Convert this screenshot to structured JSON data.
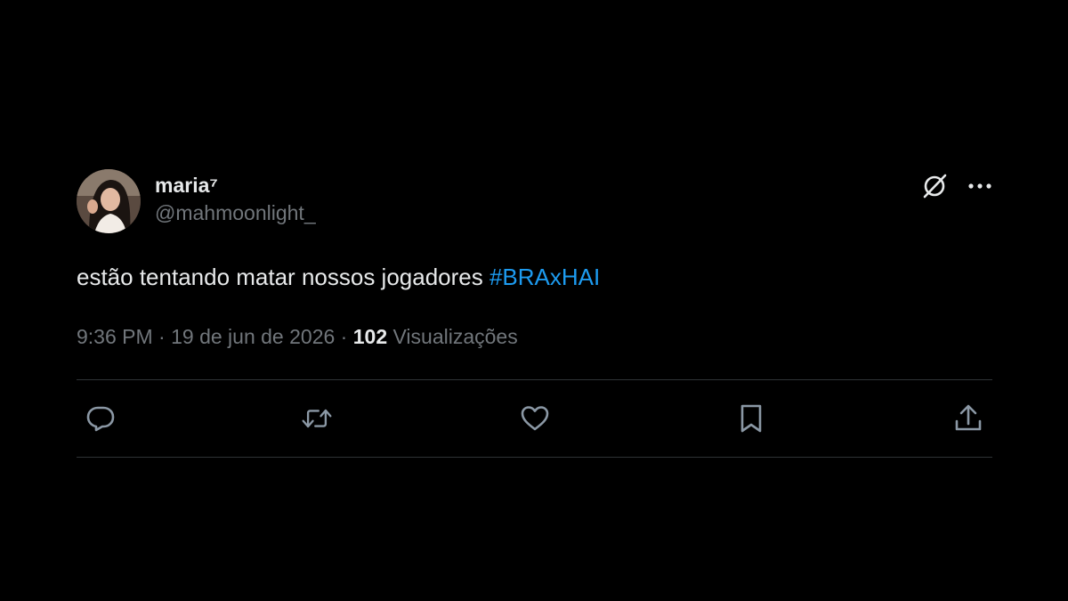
{
  "tweet": {
    "display_name": "maria⁷",
    "handle": "@mahmoonlight_",
    "text": "estão tentando matar nossos jogadores ",
    "hashtag": "#BRAxHAI",
    "time": "9:36 PM",
    "separator": "·",
    "date": "19 de jun de 2026",
    "views_count": "102",
    "views_label": "Visualizações"
  },
  "icons": {
    "header": [
      "grok-icon",
      "more-icon"
    ],
    "actions": [
      "reply-icon",
      "retweet-icon",
      "like-icon",
      "bookmark-icon",
      "share-icon"
    ]
  },
  "colors": {
    "background": "#000000",
    "text": "#e7e9ea",
    "secondary": "#71767b",
    "link": "#1d9bf0",
    "divider": "#2f3336"
  }
}
